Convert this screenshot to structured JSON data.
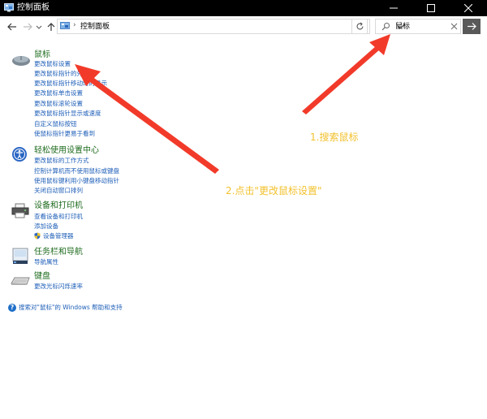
{
  "window": {
    "title": "控制面板"
  },
  "address": {
    "breadcrumb": "控制面板"
  },
  "search": {
    "query": "鼠标"
  },
  "groups": [
    {
      "title": "鼠标",
      "links": [
        "更改鼠标设置",
        "更改鼠标指针的外观",
        "更改鼠标指针移动时的显示",
        "更改鼠标单击设置",
        "更改鼠标滚轮设置",
        "更改鼠标指针显示或速度",
        "自定义鼠标按钮",
        "使鼠标指针更易于看到"
      ]
    },
    {
      "title": "轻松使用设置中心",
      "links": [
        "更改鼠标的工作方式",
        "控制计算机而不使用鼠标或键盘",
        "使用鼠标键利用小键盘移动指针",
        "关闭自动窗口排列"
      ]
    },
    {
      "title": "设备和打印机",
      "links": [
        "查看设备和打印机",
        "添加设备",
        "设备管理器"
      ]
    },
    {
      "title": "任务栏和导航",
      "links": [
        "导航属性"
      ]
    },
    {
      "title": "键盘",
      "links": [
        "更改光标闪烁速率"
      ]
    }
  ],
  "help": {
    "text": "搜索对\"鼠标\"的 Windows 帮助和支持"
  },
  "annotations": {
    "step1": "1.搜索鼠标",
    "step2": "2.点击\"更改鼠标设置\""
  },
  "colors": {
    "arrow": "#f23a2a",
    "annotation": "#f2c12e",
    "group_title": "#1e6b1e",
    "link": "#1f5fb8"
  }
}
